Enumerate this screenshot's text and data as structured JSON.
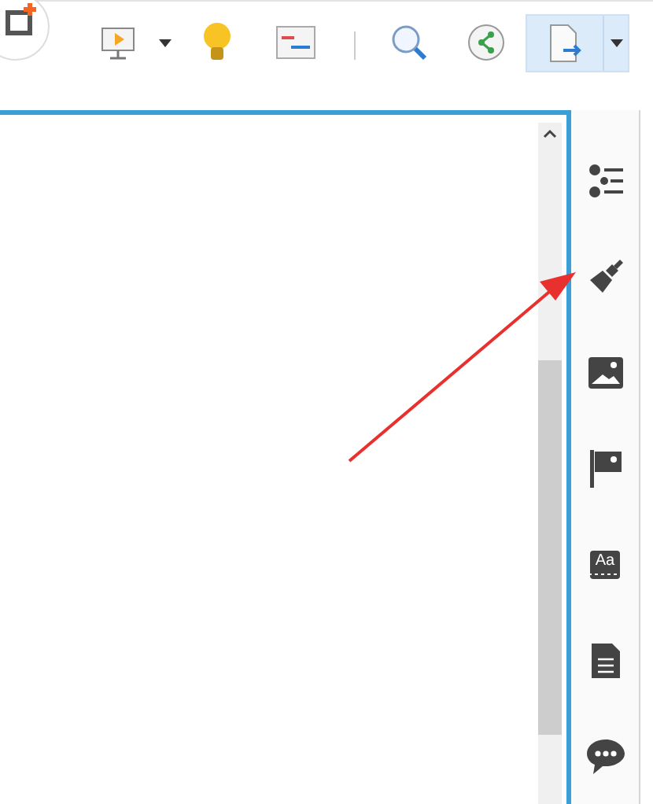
{
  "toolbar": {
    "tools": [
      {
        "kind": "add"
      },
      {
        "kind": "present"
      },
      {
        "kind": "caret"
      },
      {
        "kind": "idea"
      },
      {
        "kind": "notes"
      },
      {
        "kind": "separator"
      },
      {
        "kind": "search"
      },
      {
        "kind": "share"
      },
      {
        "kind": "export",
        "selected": true
      }
    ]
  },
  "canvas": {
    "focused": true
  },
  "sidebar": {
    "items": [
      {
        "kind": "outline"
      },
      {
        "kind": "style"
      },
      {
        "kind": "image"
      },
      {
        "kind": "marker"
      },
      {
        "kind": "text",
        "label": "Aa"
      },
      {
        "kind": "note"
      },
      {
        "kind": "comment"
      }
    ]
  }
}
